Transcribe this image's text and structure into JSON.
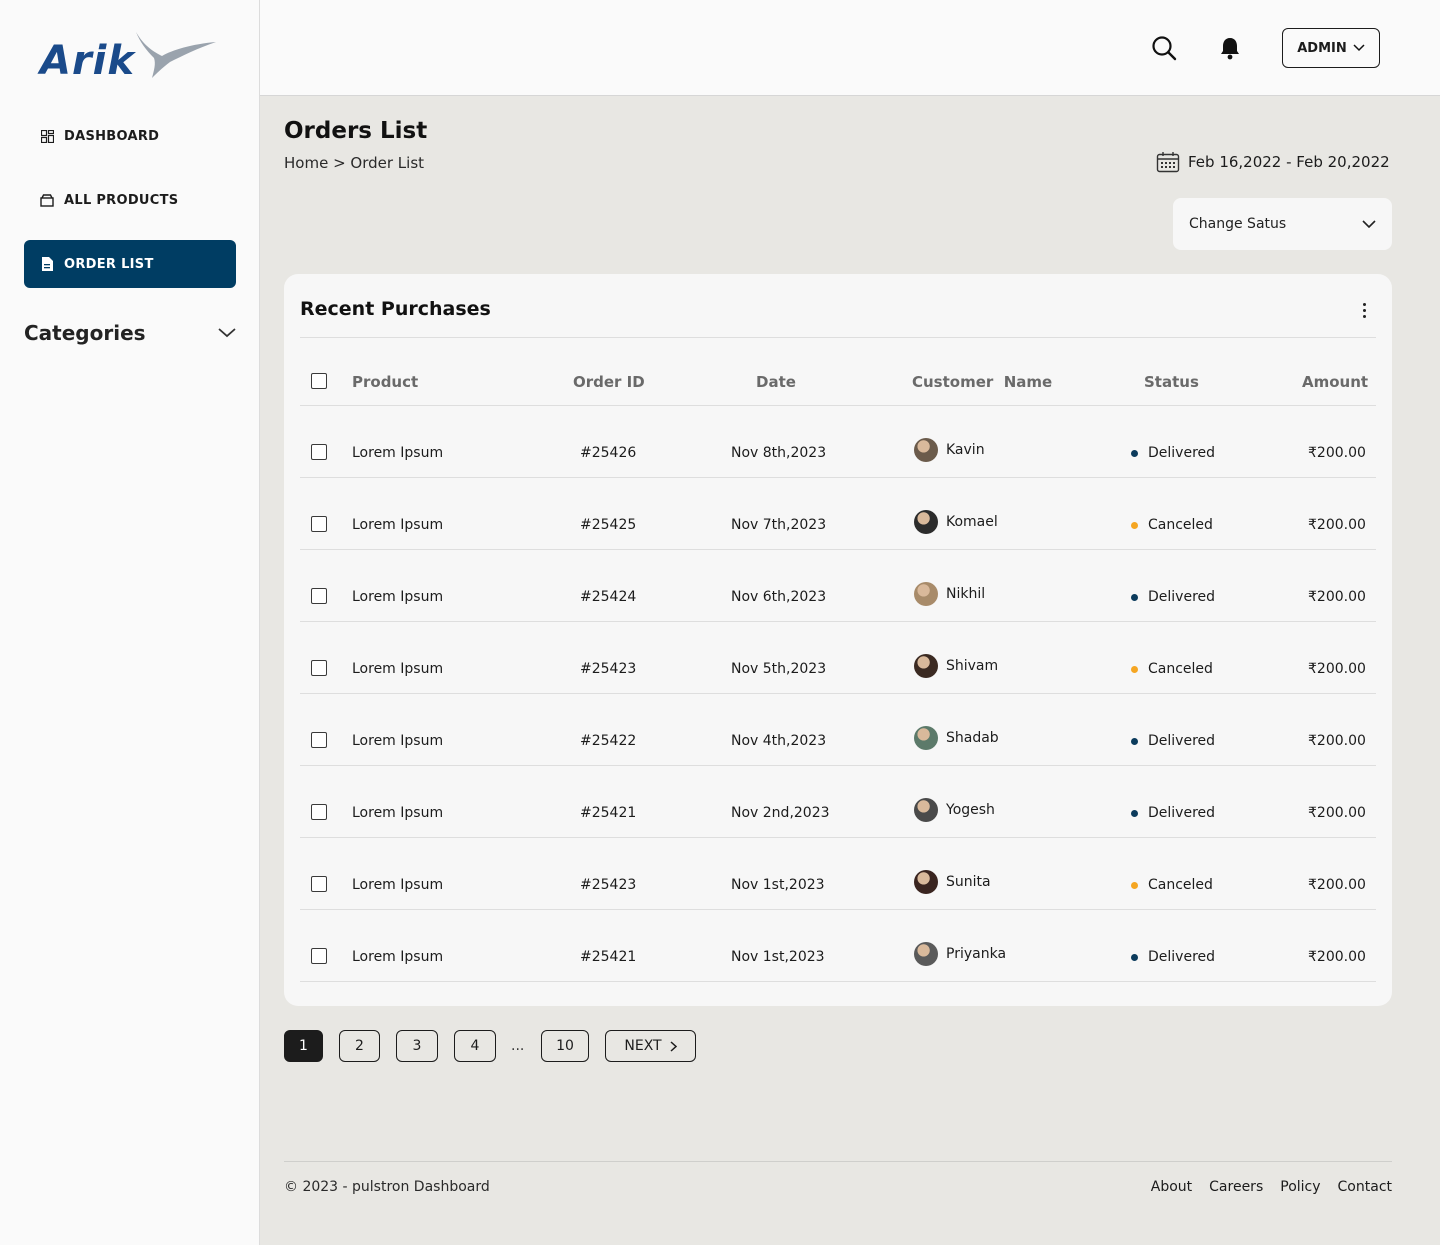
{
  "brand": {
    "logo_text": "Arik",
    "primary_color": "#003d63",
    "logo_color": "#1a4a8a"
  },
  "sidebar": {
    "items": [
      {
        "label": "DASHBOARD",
        "icon": "dashboard-grid-icon",
        "active": false
      },
      {
        "label": "ALL PRODUCTS",
        "icon": "box-icon",
        "active": false
      },
      {
        "label": "ORDER LIST",
        "icon": "document-icon",
        "active": true
      }
    ],
    "categories_label": "Categories"
  },
  "topbar": {
    "admin_label": "ADMIN"
  },
  "header": {
    "title": "Orders List",
    "breadcrumb": "Home > Order List",
    "date_range": "Feb 16,2022 - Feb 20,2022",
    "status_select": "Change Satus"
  },
  "card": {
    "title": "Recent Purchases",
    "columns": [
      "Product",
      "Order ID",
      "Date",
      "Customer  Name",
      "Status",
      "Amount"
    ],
    "rows": [
      {
        "product": "Lorem Ipsum",
        "order_id": "#25426",
        "date": "Nov 8th,2023",
        "customer": "Kavin",
        "status": "Delivered",
        "amount": "₹200.00"
      },
      {
        "product": "Lorem Ipsum",
        "order_id": "#25425",
        "date": "Nov 7th,2023",
        "customer": "Komael",
        "status": "Canceled",
        "amount": "₹200.00"
      },
      {
        "product": "Lorem Ipsum",
        "order_id": "#25424",
        "date": "Nov 6th,2023",
        "customer": "Nikhil",
        "status": "Delivered",
        "amount": "₹200.00"
      },
      {
        "product": "Lorem Ipsum",
        "order_id": "#25423",
        "date": "Nov 5th,2023",
        "customer": "Shivam",
        "status": "Canceled",
        "amount": "₹200.00"
      },
      {
        "product": "Lorem Ipsum",
        "order_id": "#25422",
        "date": "Nov 4th,2023",
        "customer": "Shadab",
        "status": "Delivered",
        "amount": "₹200.00"
      },
      {
        "product": "Lorem Ipsum",
        "order_id": "#25421",
        "date": "Nov 2nd,2023",
        "customer": "Yogesh",
        "status": "Delivered",
        "amount": "₹200.00"
      },
      {
        "product": "Lorem Ipsum",
        "order_id": "#25423",
        "date": "Nov 1st,2023",
        "customer": "Sunita",
        "status": "Canceled",
        "amount": "₹200.00"
      },
      {
        "product": "Lorem Ipsum",
        "order_id": "#25421",
        "date": "Nov 1st,2023",
        "customer": "Priyanka",
        "status": "Delivered",
        "amount": "₹200.00"
      }
    ],
    "status_colors": {
      "Delivered": "#0b3b5c",
      "Canceled": "#f5a623"
    }
  },
  "pagination": {
    "pages": [
      "1",
      "2",
      "3",
      "4",
      "10"
    ],
    "ellipsis": "...",
    "next_label": "NEXT",
    "current": "1"
  },
  "footer": {
    "copyright": "© 2023 - pulstron Dashboard",
    "links": [
      "About",
      "Careers",
      "Policy",
      "Contact"
    ]
  }
}
